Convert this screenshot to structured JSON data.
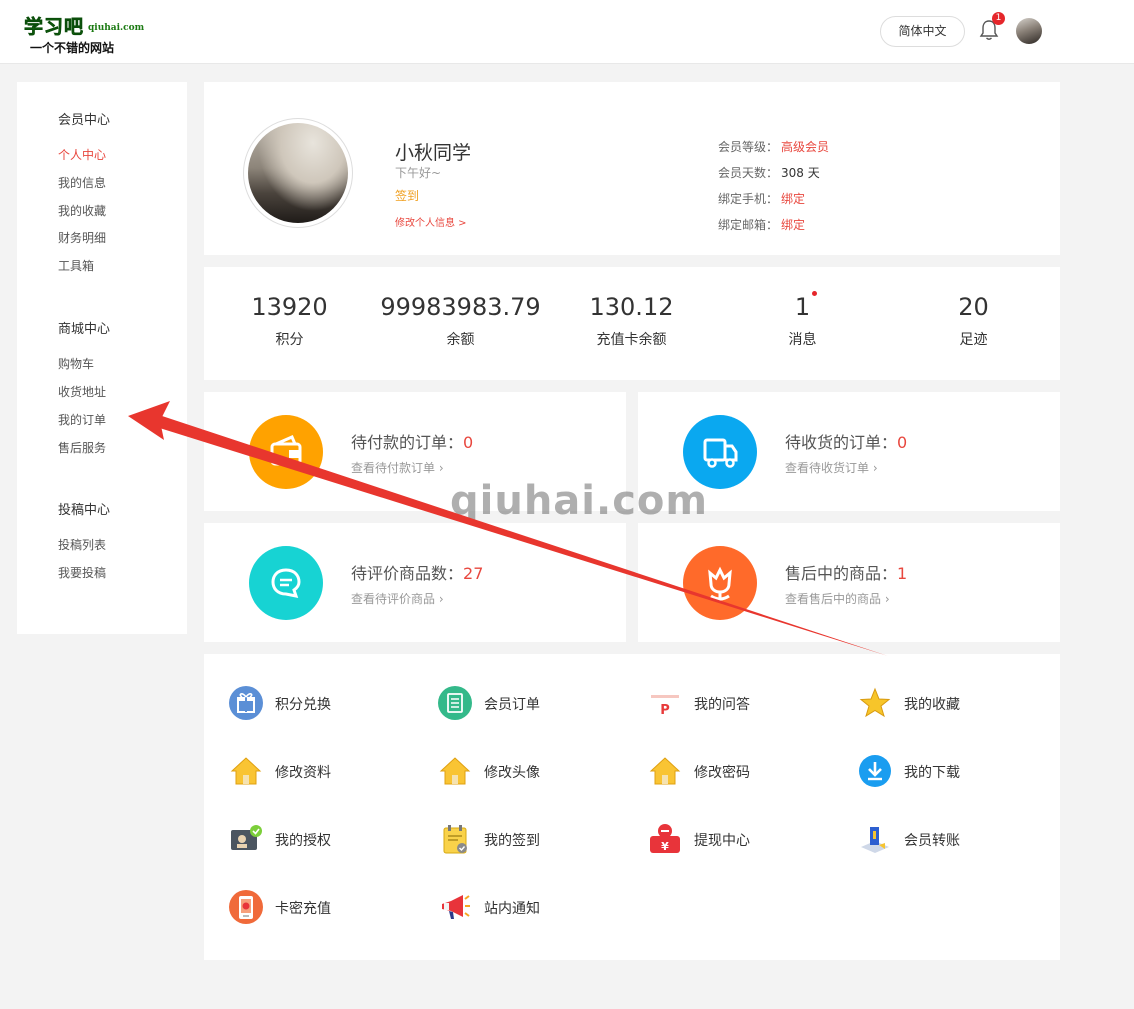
{
  "header": {
    "logo_main": "学习吧",
    "logo_domain": "qiuhai.com",
    "logo_slogan": "一个不错的网站",
    "language_button": "简体中文",
    "notification_count": "1"
  },
  "sidebar": {
    "groups": [
      {
        "title": "会员中心",
        "items": [
          "个人中心",
          "我的信息",
          "我的收藏",
          "财务明细",
          "工具箱"
        ]
      },
      {
        "title": "商城中心",
        "items": [
          "购物车",
          "收货地址",
          "我的订单",
          "售后服务"
        ]
      },
      {
        "title": "投稿中心",
        "items": [
          "投稿列表",
          "我要投稿"
        ]
      }
    ],
    "active_item": "个人中心"
  },
  "profile": {
    "username": "小秋同学",
    "greeting": "下午好~",
    "signin_label": "签到",
    "edit_link": "修改个人信息 >",
    "meta": [
      {
        "label": "会员等级：",
        "value": "高级会员"
      },
      {
        "label": "会员天数：",
        "value": "308 天"
      },
      {
        "label": "绑定手机：",
        "value": "绑定"
      },
      {
        "label": "绑定邮箱：",
        "value": "绑定"
      }
    ]
  },
  "stats": [
    {
      "value": "13920",
      "label": "积分"
    },
    {
      "value": "99983983.79",
      "label": "余额"
    },
    {
      "value": "130.12",
      "label": "充值卡余额"
    },
    {
      "value": "1",
      "label": "消息"
    },
    {
      "value": "20",
      "label": "足迹"
    }
  ],
  "orders": [
    {
      "title": "待付款的订单：",
      "count": "0",
      "link": "查看待付款订单",
      "icon": "wallet-icon",
      "color": "#ffa200"
    },
    {
      "title": "待收货的订单：",
      "count": "0",
      "link": "查看待收货订单",
      "icon": "truck-icon",
      "color": "#0aa8f0"
    },
    {
      "title": "待评价商品数：",
      "count": "27",
      "link": "查看待评价商品",
      "icon": "comment-icon",
      "color": "#17d3d3"
    },
    {
      "title": "售后中的商品：",
      "count": "1",
      "link": "查看售后中的商品",
      "icon": "flower-icon",
      "color": "#ff6a2a"
    }
  ],
  "tools": [
    {
      "label": "积分兑换",
      "icon": "gift-icon"
    },
    {
      "label": "会员订单",
      "icon": "list-icon"
    },
    {
      "label": "我的问答",
      "icon": "qa-icon"
    },
    {
      "label": "我的收藏",
      "icon": "star-icon"
    },
    {
      "label": "修改资料",
      "icon": "house-icon"
    },
    {
      "label": "修改头像",
      "icon": "house-icon"
    },
    {
      "label": "修改密码",
      "icon": "house-icon"
    },
    {
      "label": "我的下载",
      "icon": "download-icon"
    },
    {
      "label": "我的授权",
      "icon": "license-icon"
    },
    {
      "label": "我的签到",
      "icon": "calendar-icon"
    },
    {
      "label": "提现中心",
      "icon": "withdraw-icon"
    },
    {
      "label": "会员转账",
      "icon": "transfer-icon"
    },
    {
      "label": "卡密充值",
      "icon": "card-icon"
    },
    {
      "label": "站内通知",
      "icon": "megaphone-icon"
    }
  ],
  "watermark": "qiuhai.com",
  "colors": {
    "accent_red": "#e8473e",
    "signin_orange": "#f0a020",
    "arrow_red": "#e8362e"
  }
}
